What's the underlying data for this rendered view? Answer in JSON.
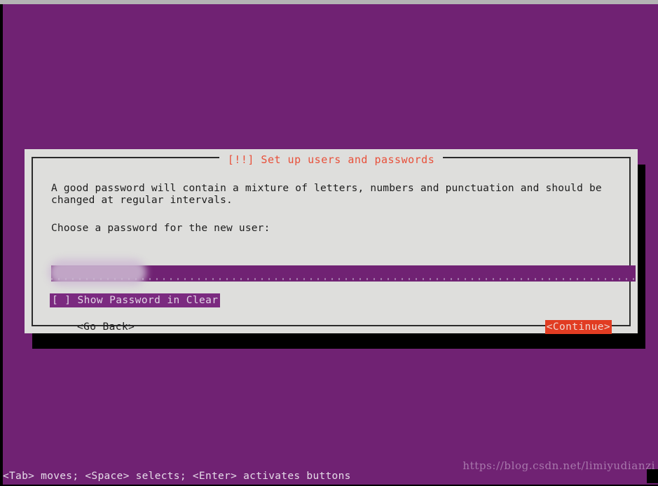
{
  "screen": {
    "background_color": "#702273",
    "frame_color": "#000000",
    "top_bar_color": "#b4b4b4"
  },
  "dialog": {
    "title": "[!!] Set up users and passwords",
    "title_color": "#e8503a",
    "background_color": "#dededc",
    "border_color": "#2b2b2b",
    "intro_text": "A good password will contain a mixture of letters, numbers and punctuation and should be\nchanged at regular intervals.",
    "prompt_text": "Choose a password for the new user:",
    "password_field": {
      "value": "",
      "placeholder": "",
      "field_color": "#702273",
      "redacted": "true"
    },
    "show_password_checkbox": {
      "label": "[ ] Show Password in Clear",
      "checked": "false",
      "highlight_color": "#7b2a80"
    },
    "buttons": {
      "go_back_label": "<Go Back>",
      "continue_label": "<Continue>",
      "continue_highlight_color": "#e13c22"
    }
  },
  "status_bar": {
    "help_text": "<Tab> moves; <Space> selects; <Enter> activates buttons"
  },
  "watermark": {
    "text": "https://blog.csdn.net/limiyudianzi"
  }
}
